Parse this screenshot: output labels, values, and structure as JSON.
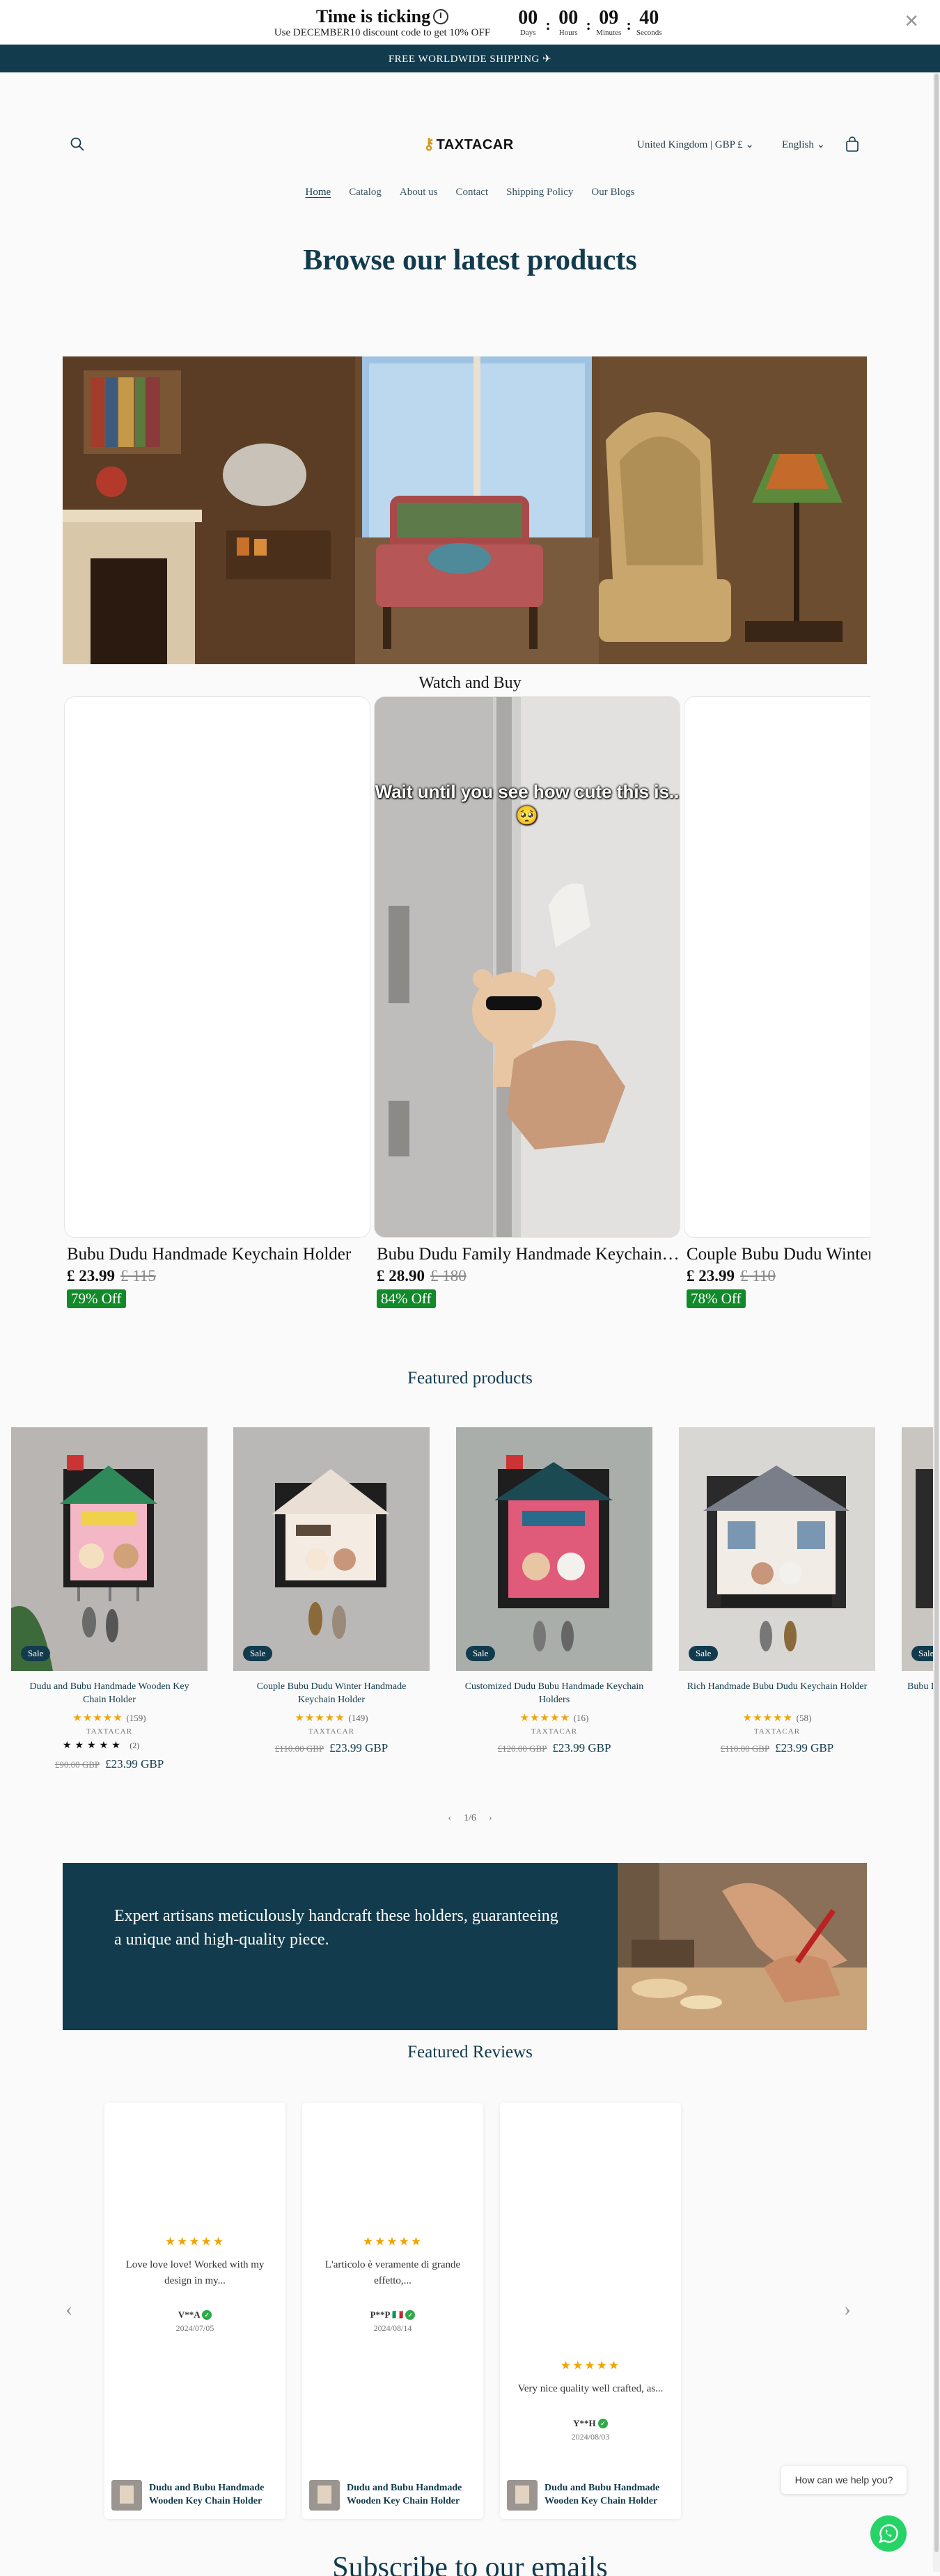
{
  "countdown": {
    "title": "Time is ticking",
    "subtitle": "Use DECEMBER10 discount code to get 10% OFF",
    "units": [
      {
        "value": "00",
        "label": "Days"
      },
      {
        "value": "00",
        "label": "Hours"
      },
      {
        "value": "09",
        "label": "Minutes"
      },
      {
        "value": "40",
        "label": "Seconds"
      }
    ],
    "close": "✕"
  },
  "announcement": "FREE WORLDWIDE SHIPPING ✈",
  "header": {
    "logo": "TAXTACAR",
    "country": "United Kingdom | GBP £",
    "language": "English"
  },
  "nav": [
    "Home",
    "Catalog",
    "About us",
    "Contact",
    "Shipping Policy",
    "Our Blogs"
  ],
  "browse_title": "Browse our latest products",
  "watch_title": "Watch and Buy",
  "videos": [
    {
      "title": "Bubu Dudu Handmade Keychain Holder",
      "price": "£ 23.99",
      "compare": "£ 115",
      "off": "79% Off"
    },
    {
      "title": "Bubu Dudu Family Handmade Keychain Holder",
      "price": "£ 28.90",
      "compare": "£ 180",
      "off": "84% Off",
      "overlay": "Wait until you see how cute this is.. 🥺"
    },
    {
      "title": "Couple Bubu Dudu Winter Handmade Keychain Holder",
      "price": "£ 23.99",
      "compare": "£ 110",
      "off": "78% Off"
    }
  ],
  "featured_title": "Featured products",
  "products": [
    {
      "name": "Dudu and Bubu Handmade Wooden Key Chain Holder",
      "rating_count": "(159)",
      "vendor": "TAXTACAR",
      "rating2": "(2)",
      "compare": "£90.00 GBP",
      "price": "£23.99 GBP",
      "sale": "Sale"
    },
    {
      "name": "Couple Bubu Dudu Winter Handmade Keychain Holder",
      "rating_count": "(149)",
      "vendor": "TAXTACAR",
      "compare": "£110.00 GBP",
      "price": "£23.99 GBP",
      "sale": "Sale"
    },
    {
      "name": "Customized Dudu Bubu Handmade Keychain Holders",
      "rating_count": "(16)",
      "vendor": "TAXTACAR",
      "compare": "£120.00 GBP",
      "price": "£23.99 GBP",
      "sale": "Sale"
    },
    {
      "name": "Rich Handmade Bubu Dudu Keychain Holder",
      "rating_count": "(58)",
      "vendor": "TAXTACAR",
      "compare": "£110.00 GBP",
      "price": "£23.99 GBP",
      "sale": "Sale"
    },
    {
      "name": "Bubu Dudu",
      "sale": "Sale"
    }
  ],
  "pager": "1/6",
  "banner_text": "Expert artisans meticulously handcraft these holders, guaranteeing a unique and high-quality piece.",
  "reviews_title": "Featured Reviews",
  "reviews": [
    {
      "stars": "★★★★★",
      "text": "Love love love! Worked with my design in my...",
      "author": "V**A",
      "date": "2024/07/05",
      "product": "Dudu and Bubu Handmade Wooden Key Chain Holder"
    },
    {
      "stars": "★★★★★",
      "text": "L'articolo è veramente di grande effetto,...",
      "author": "P**P 🇮🇹",
      "date": "2024/08/14",
      "product": "Dudu and Bubu Handmade Wooden Key Chain Holder"
    },
    {
      "stars": "★★★★★",
      "text": "Very nice quality well crafted, as...",
      "author": "Y**H",
      "date": "2024/08/03",
      "product": "Dudu and Bubu Handmade Wooden Key Chain Holder"
    }
  ],
  "subscribe_title": "Subscribe to our emails",
  "chat_prompt": "How can we help you?",
  "colors": {
    "brand": "#123b4d",
    "sale_badge": "#128a2a",
    "star": "#f0a500",
    "whatsapp": "#25d366"
  }
}
